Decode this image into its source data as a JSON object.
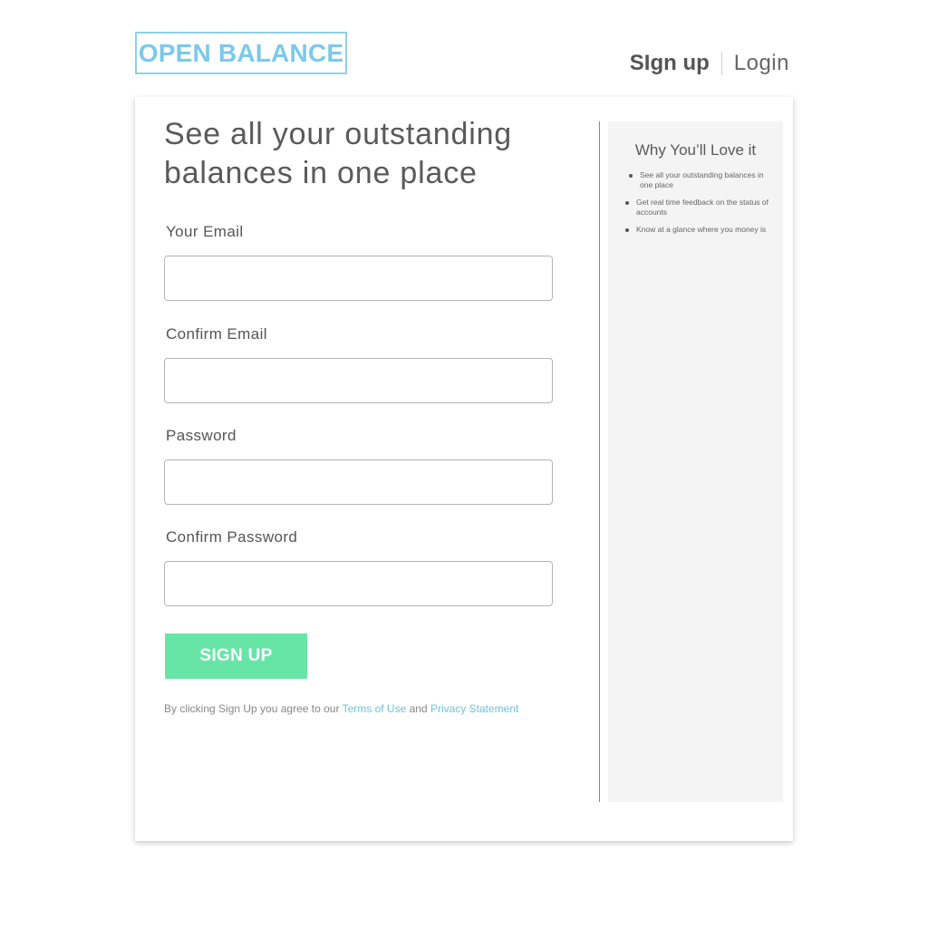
{
  "header": {
    "logo_text": "OPEN BALANCE",
    "nav": {
      "signup_label": "SIgn up",
      "login_label": "Login"
    }
  },
  "form": {
    "headline": "See all your outstanding balances in one place",
    "fields": [
      {
        "label": "Your Email",
        "value": "",
        "placeholder": ""
      },
      {
        "label": "Confirm Email",
        "value": "",
        "placeholder": ""
      },
      {
        "label": "Password",
        "value": "",
        "placeholder": ""
      },
      {
        "label": "Confirm Password",
        "value": "",
        "placeholder": ""
      }
    ],
    "submit_label": "SIGN UP",
    "legal": {
      "prefix": "By clicking Sign Up you agree to our ",
      "terms_link": "Terms of Use",
      "conjunction": " and ",
      "privacy_link": "Privacy Statement"
    }
  },
  "sidebar": {
    "title": "Why You’ll Love it",
    "bullets": [
      "See all your outstanding balances in one place",
      "Get real time feedback on the status of accounts",
      "Know at a glance where you money is"
    ]
  },
  "colors": {
    "brand_blue": "#7cc9ea",
    "signup_green": "#67e5a7",
    "link_blue": "#6cc4dd",
    "sidebar_bg": "#f4f4f4"
  }
}
